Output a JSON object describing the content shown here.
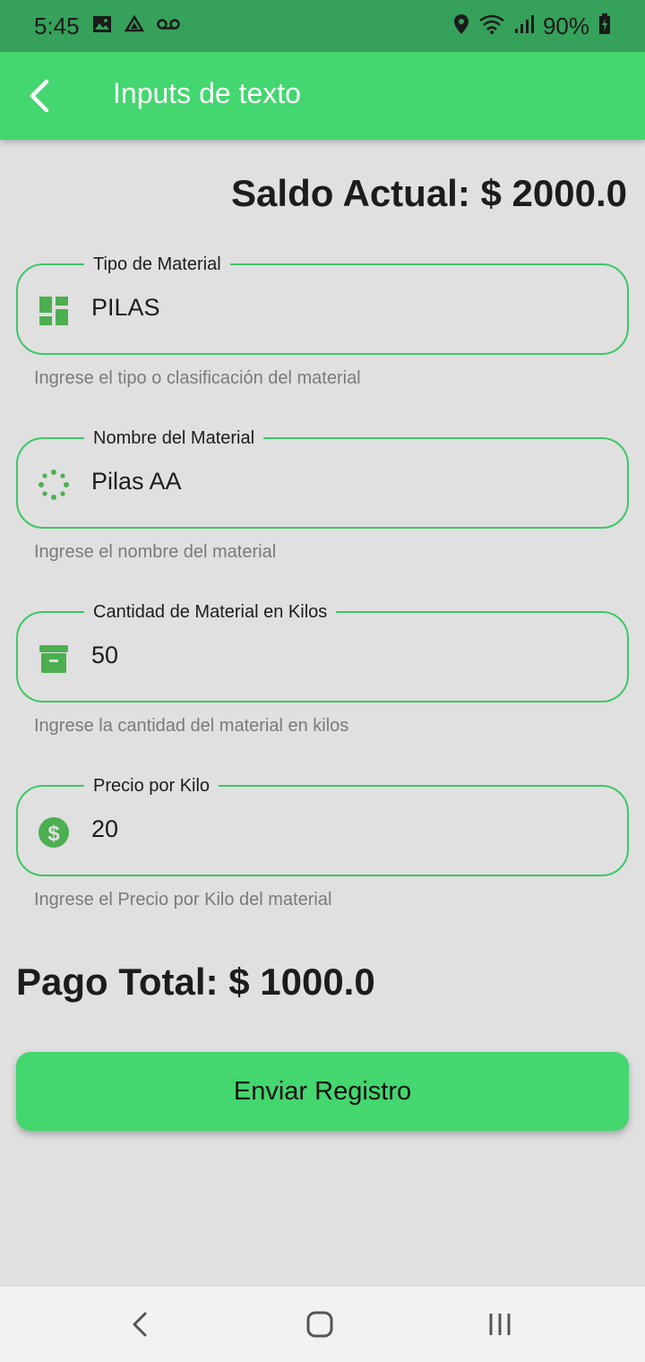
{
  "status_bar": {
    "time": "5:45",
    "battery": "90%",
    "icons": [
      "gallery-icon",
      "drive-icon",
      "voicemail-icon",
      "location-icon",
      "wifi-icon",
      "signal-icon",
      "battery-charging-icon"
    ]
  },
  "app_bar": {
    "title": "Inputs de texto",
    "back_icon": "back-arrow-icon",
    "color": "#44d66f"
  },
  "saldo": "Saldo Actual: $ 2000.0",
  "fields": [
    {
      "label": "Tipo de Material",
      "value": "PILAS",
      "helper": "Ingrese el tipo o clasificación del material",
      "icon": "dashboard-icon"
    },
    {
      "label": "Nombre del Material",
      "value": "Pilas AA",
      "helper": "Ingrese el nombre del material",
      "icon": "loading-dots-icon"
    },
    {
      "label": "Cantidad de Material en Kilos",
      "value": "50",
      "helper": "Ingrese la cantidad del material en kilos",
      "icon": "archive-box-icon"
    },
    {
      "label": "Precio por Kilo",
      "value": "20",
      "helper": "Ingrese el Precio por Kilo del material",
      "icon": "dollar-circle-icon"
    }
  ],
  "pago_total": "Pago Total: $ 1000.0",
  "submit_label": "Enviar Registro",
  "colors": {
    "accent": "#44d66f",
    "status_bar": "#35a15a",
    "field_border": "#3cc765",
    "icon": "#4caf50"
  }
}
